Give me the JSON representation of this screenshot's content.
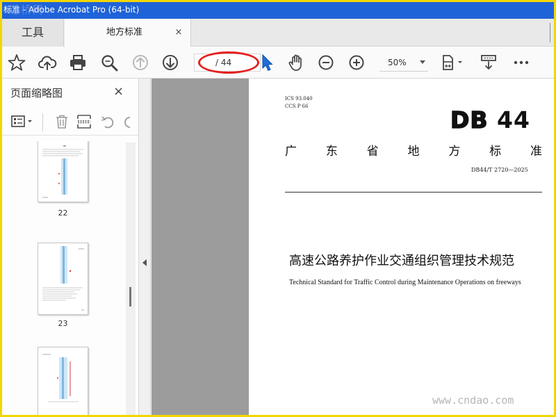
{
  "window": {
    "title": "标准 - Adobe Acrobat Pro (64-bit)",
    "watermark_logo": "道桥网",
    "watermark_site": "www.cndao.com"
  },
  "tabs": {
    "tools_label": "工具",
    "doc_label": "地方标准",
    "close_glyph": "×"
  },
  "toolbar": {
    "page_total": "/ 44",
    "zoom": "50%",
    "icons": [
      "star-icon",
      "cloud-upload-icon",
      "print-icon",
      "zoom-search-icon",
      "page-up-icon",
      "page-down-icon",
      "select-cursor-icon",
      "hand-tool-icon",
      "zoom-out-icon",
      "zoom-in-icon",
      "page-fit-icon",
      "scroll-mode-icon",
      "more-icon"
    ],
    "highlight_color": "#e51f1f"
  },
  "left_panel": {
    "title": "页面缩略图",
    "close_glyph": "×",
    "thumbnails": [
      {
        "page": "22"
      },
      {
        "page": "23"
      },
      {
        "page": ""
      }
    ]
  },
  "document": {
    "ics": "ICS  93.040",
    "ccs": "CCS  P  66",
    "db": "DB",
    "db_num": "44",
    "province_chars": [
      "广",
      "东",
      "省",
      "地",
      "方",
      "标",
      "准"
    ],
    "standard_no": "DB44/T 2720—2025",
    "title_cn": "高速公路养护作业交通组织管理技术规范",
    "title_en": "Technical Standard for Traffic Control during Maintenance Operations on freeways"
  },
  "colors": {
    "title_bar": "#1f63d8",
    "frame": "#f2d600",
    "accent_cursor": "#1f6fd6"
  }
}
